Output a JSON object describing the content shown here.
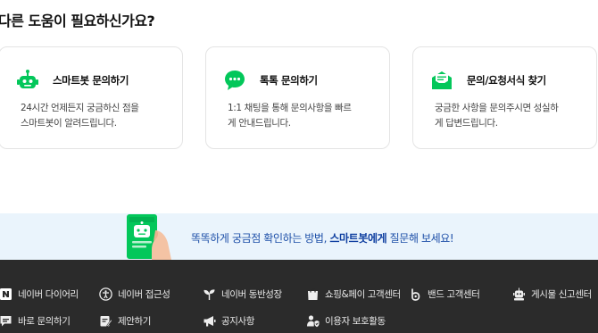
{
  "section_title": "다른 도움이 필요하신가요?",
  "cards": [
    {
      "title": "스마트봇 문의하기",
      "desc": [
        "24시간 언제든지 궁금하신 점을",
        "스마트봇이 알려드립니다."
      ],
      "icon": "robot-icon"
    },
    {
      "title": "톡톡 문의하기",
      "desc": [
        "1:1 채팅을 통해 문의사항을 빠르",
        "게 안내드립니다."
      ],
      "icon": "chat-bubble-icon"
    },
    {
      "title": "문의/요청서식 찾기",
      "desc": [
        "궁금한 사항을 문의주시면 성실하",
        "게 답변드립니다."
      ],
      "icon": "envelope-icon"
    }
  ],
  "banner": {
    "text_before": "똑똑하게 궁금점  확인하는 방법, ",
    "text_bold": "스마트봇에게",
    "text_after": " 질문해 보세요!"
  },
  "footer": {
    "row1": [
      {
        "label": "네이버 다이어리",
        "icon": "naver-logo-icon"
      },
      {
        "label": "네이버 접근성",
        "icon": "accessibility-icon"
      },
      {
        "label": "네이버 동반성장",
        "icon": "sprout-icon"
      },
      {
        "label": "쇼핑&페이 고객센터",
        "icon": "shopping-bag-icon"
      },
      {
        "label": "밴드 고객센터",
        "icon": "band-logo-icon"
      },
      {
        "label": "게시물 신고센터",
        "icon": "robot-siren-icon"
      }
    ],
    "row2": [
      {
        "label": "바로 문의하기",
        "icon": "chat-icon"
      },
      {
        "label": "제안하기",
        "icon": "pencil-note-icon"
      },
      {
        "label": "공지사항",
        "icon": "megaphone-icon"
      },
      {
        "label": "이용자 보호활동",
        "icon": "user-shield-icon"
      }
    ]
  },
  "colors": {
    "brand_green": "#03c75a",
    "banner_bg": "#eaf4fc",
    "footer_bg": "#2b2b2b",
    "banner_text": "#1d4fa8"
  }
}
